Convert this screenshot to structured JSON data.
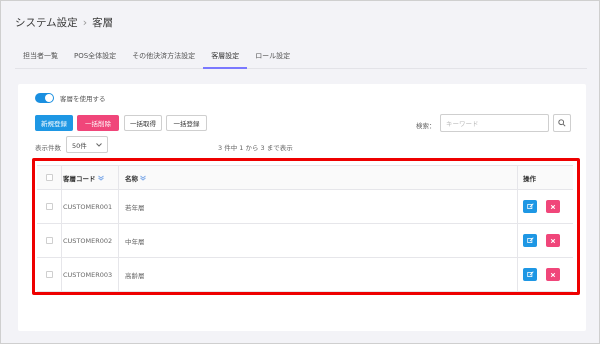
{
  "header": {
    "title": "システム設定",
    "current": "客層"
  },
  "tabs": [
    {
      "label": "担当者一覧"
    },
    {
      "label": "POS全体設定"
    },
    {
      "label": "その他決済方法設定"
    },
    {
      "label": "客層設定"
    },
    {
      "label": "ロール設定"
    }
  ],
  "active_tab": "客層設定",
  "toggle": {
    "label": "客層を使用する",
    "enabled": true
  },
  "toolbar": {
    "new": "新規登録",
    "bulk_delete": "一括削除",
    "bulk_get": "一括取得",
    "bulk_register": "一括登録"
  },
  "search": {
    "label": "検索：",
    "placeholder": "キーワード"
  },
  "per_page": {
    "label": "表示件数",
    "value": "50件"
  },
  "result_info": "3 件中 1 から 3 まで表示",
  "table": {
    "headers": {
      "code": "客層コード",
      "name": "名称",
      "actions": "操作"
    },
    "rows": [
      {
        "code": "CUSTOMER001",
        "name": "若年層"
      },
      {
        "code": "CUSTOMER002",
        "name": "中年層"
      },
      {
        "code": "CUSTOMER003",
        "name": "高齢層"
      }
    ]
  },
  "colors": {
    "primary": "#1e97e4",
    "danger": "#f0467a",
    "highlight": "#ee0000",
    "tab_underline": "#7a78ff"
  }
}
